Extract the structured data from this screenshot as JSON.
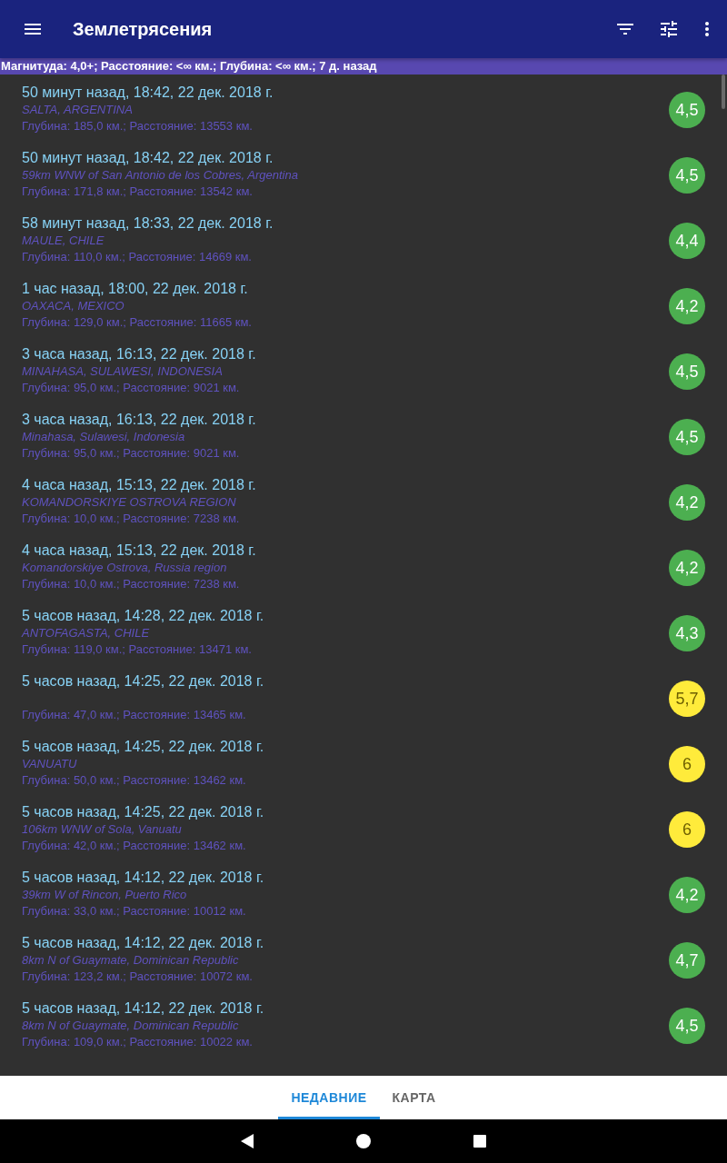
{
  "app_bar": {
    "title": "Землетрясения"
  },
  "filter_summary": "Магнитуда: 4,0+; Расстояние: <∞ км.; Глубина: <∞ км.; 7 д. назад",
  "earthquakes": [
    {
      "time": "50 минут назад, 18:42, 22 дек. 2018 г.",
      "place": "SALTA, ARGENTINA",
      "details": "Глубина: 185,0 км.; Расстояние: 13553 км.",
      "magnitude": "4,5",
      "color": "#4caf50"
    },
    {
      "time": "50 минут назад, 18:42, 22 дек. 2018 г.",
      "place": "59km WNW of San Antonio de los Cobres, Argentina",
      "details": "Глубина: 171,8 км.; Расстояние: 13542 км.",
      "magnitude": "4,5",
      "color": "#4caf50"
    },
    {
      "time": "58 минут назад, 18:33, 22 дек. 2018 г.",
      "place": "MAULE, CHILE",
      "details": "Глубина: 110,0 км.; Расстояние: 14669 км.",
      "magnitude": "4,4",
      "color": "#4caf50"
    },
    {
      "time": "1 час назад, 18:00, 22 дек. 2018 г.",
      "place": "OAXACA, MEXICO",
      "details": "Глубина: 129,0 км.; Расстояние: 11665 км.",
      "magnitude": "4,2",
      "color": "#4caf50"
    },
    {
      "time": "3 часа назад, 16:13, 22 дек. 2018 г.",
      "place": "MINAHASA, SULAWESI, INDONESIA",
      "details": "Глубина: 95,0 км.; Расстояние: 9021 км.",
      "magnitude": "4,5",
      "color": "#4caf50"
    },
    {
      "time": "3 часа назад, 16:13, 22 дек. 2018 г.",
      "place": "Minahasa, Sulawesi, Indonesia",
      "details": "Глубина: 95,0 км.; Расстояние: 9021 км.",
      "magnitude": "4,5",
      "color": "#4caf50"
    },
    {
      "time": "4 часа назад, 15:13, 22 дек. 2018 г.",
      "place": "KOMANDORSKIYE OSTROVA REGION",
      "details": "Глубина: 10,0 км.; Расстояние: 7238 км.",
      "magnitude": "4,2",
      "color": "#4caf50"
    },
    {
      "time": "4 часа назад, 15:13, 22 дек. 2018 г.",
      "place": "Komandorskiye Ostrova, Russia region",
      "details": "Глубина: 10,0 км.; Расстояние: 7238 км.",
      "magnitude": "4,2",
      "color": "#4caf50"
    },
    {
      "time": "5 часов назад, 14:28, 22 дек. 2018 г.",
      "place": "ANTOFAGASTA, CHILE",
      "details": "Глубина: 119,0 км.; Расстояние: 13471 км.",
      "magnitude": "4,3",
      "color": "#4caf50"
    },
    {
      "time": "5 часов назад, 14:25, 22 дек. 2018 г.",
      "details": "Глубина: 47,0 км.; Расстояние: 13465 км.",
      "magnitude": "5,7",
      "color": "#ffeb3b"
    },
    {
      "time": "5 часов назад, 14:25, 22 дек. 2018 г.",
      "place": "VANUATU",
      "details": "Глубина: 50,0 км.; Расстояние: 13462 км.",
      "magnitude": "6",
      "color": "#ffeb3b"
    },
    {
      "time": "5 часов назад, 14:25, 22 дек. 2018 г.",
      "place": "106km WNW of Sola, Vanuatu",
      "details": "Глубина: 42,0 км.; Расстояние: 13462 км.",
      "magnitude": "6",
      "color": "#ffeb3b"
    },
    {
      "time": "5 часов назад, 14:12, 22 дек. 2018 г.",
      "place": "39km W of Rincon, Puerto Rico",
      "details": "Глубина: 33,0 км.; Расстояние: 10012 км.",
      "magnitude": "4,2",
      "color": "#4caf50"
    },
    {
      "time": "5 часов назад, 14:12, 22 дек. 2018 г.",
      "place": "8km N of Guaymate, Dominican Republic",
      "details": "Глубина: 123,2 км.; Расстояние: 10072 км.",
      "magnitude": "4,7",
      "color": "#4caf50"
    },
    {
      "time": "5 часов назад, 14:12, 22 дек. 2018 г.",
      "place": "8km N of Guaymate, Dominican Republic",
      "details": "Глубина: 109,0 км.; Расстояние: 10022 км.",
      "magnitude": "4,5",
      "color": "#4caf50"
    }
  ],
  "tabs": [
    {
      "label": "НЕДАВНИЕ",
      "selected": true
    },
    {
      "label": "КАРТА",
      "selected": false
    }
  ]
}
